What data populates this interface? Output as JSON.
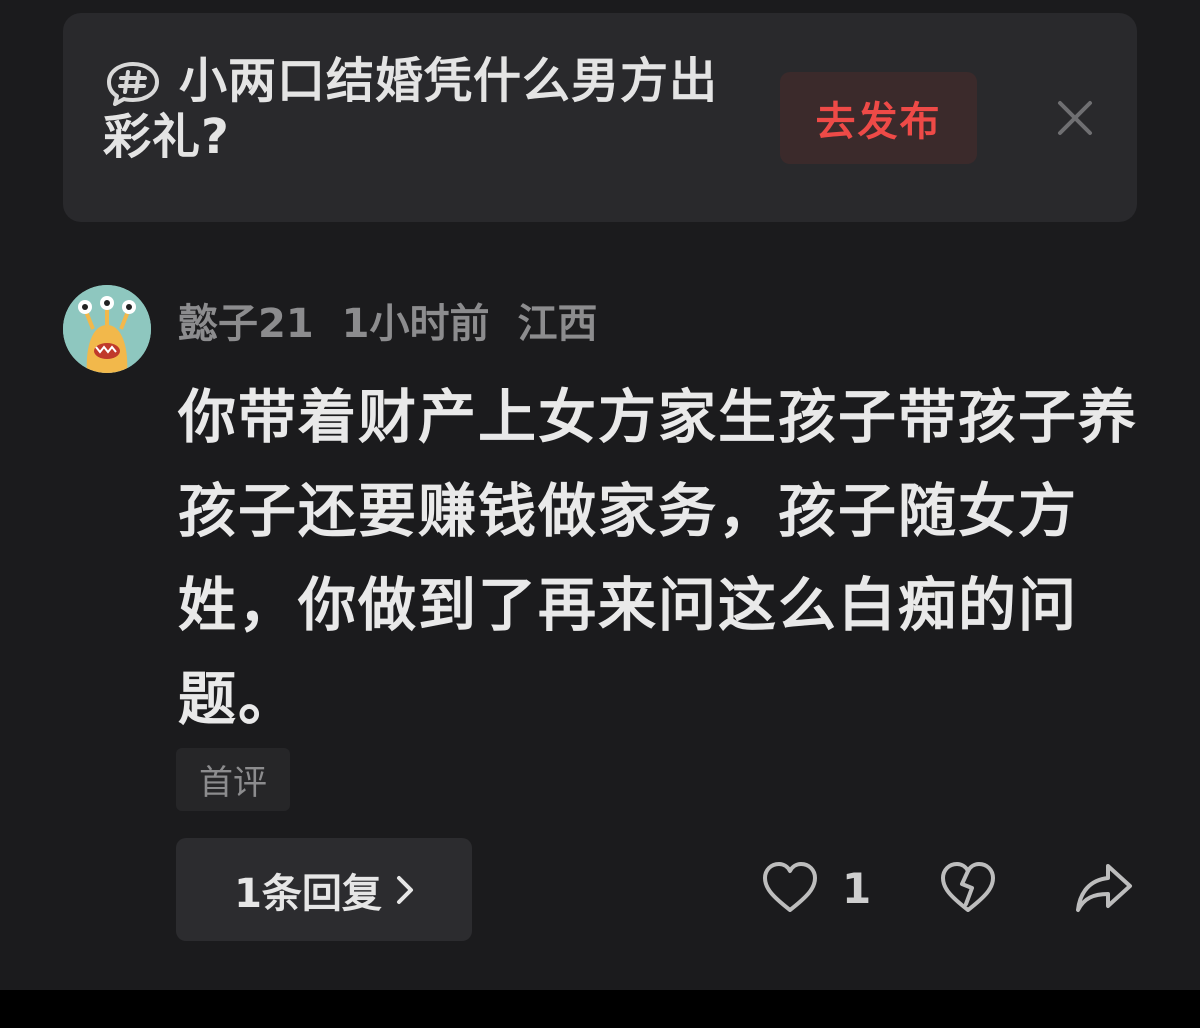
{
  "topic": {
    "title": "小两口结婚凭什么男方出彩礼?",
    "publish_label": "去发布",
    "hash_icon": "hash-bubble-icon",
    "close_icon": "close-icon"
  },
  "comment": {
    "username": "懿子21",
    "time": "1小时前",
    "location": "江西",
    "text": "你带着财产上女方家生孩子带孩子养孩子还要赚钱做家务，孩子随女方姓，你做到了再来问这么白痴的问题。",
    "badge": "首评",
    "replies_label": "1条回复",
    "like_count": "1"
  },
  "colors": {
    "background": "#1b1b1d",
    "card": "#29292c",
    "accent_red": "#ee4a47",
    "muted": "#8c8c8e"
  }
}
